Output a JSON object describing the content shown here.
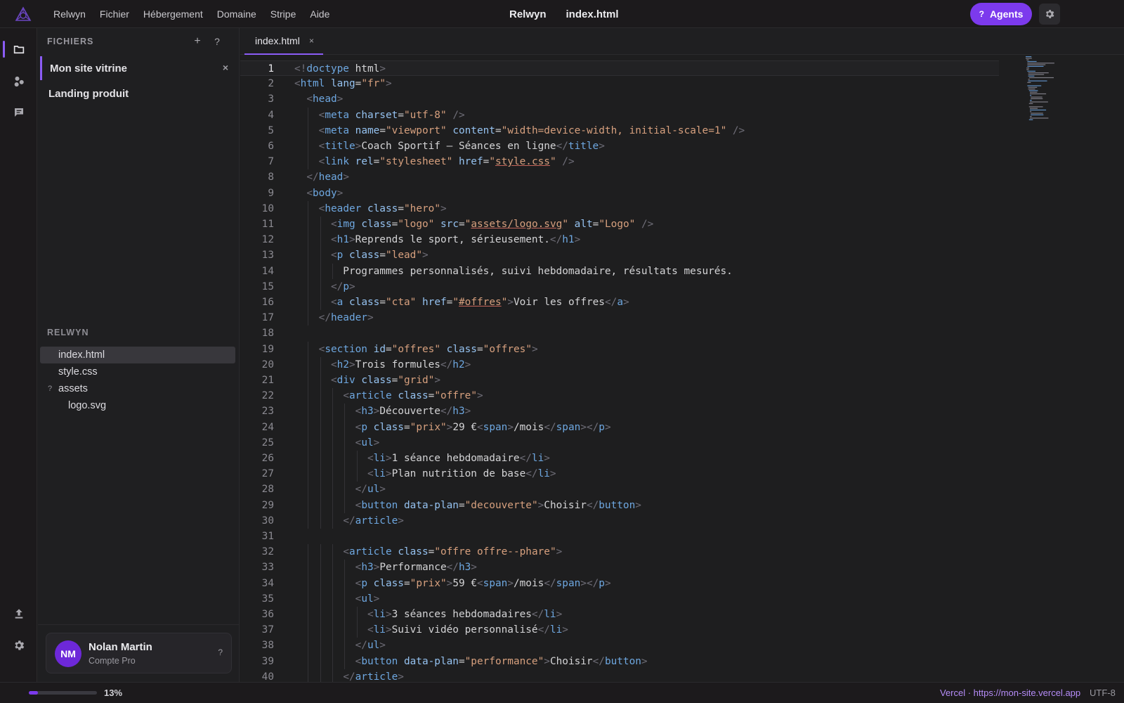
{
  "topbar": {
    "menu": [
      "Relwyn",
      "Fichier",
      "Hébergement",
      "Domaine",
      "Stripe",
      "Aide"
    ],
    "app_name": "Relwyn",
    "file_name": "index.html",
    "agents_q": "?",
    "agents_label": "Agents",
    "accent_color": "#7c3aed"
  },
  "activity_bar": {
    "icons": [
      "files-icon",
      "extensions-icon",
      "chat-icon",
      "upload-icon",
      "settings-icon"
    ]
  },
  "sidebar": {
    "header": "FICHIERS",
    "add_symbol": "+",
    "help_symbol": "?",
    "projects": [
      {
        "label": "Mon site vitrine",
        "active": true,
        "close": "×"
      },
      {
        "label": "Landing produit",
        "active": false
      }
    ],
    "section_label": "RELWYN",
    "tree": [
      {
        "label": "index.html",
        "active": true,
        "level": 0
      },
      {
        "label": "style.css",
        "level": 0
      },
      {
        "label": "assets",
        "level": 0,
        "marker": "?"
      },
      {
        "label": "logo.svg",
        "level": 1
      }
    ],
    "user": {
      "initials": "NM",
      "name": "Nolan Martin",
      "plan": "Compte Pro",
      "help": "?"
    }
  },
  "editor": {
    "tab_label": "index.html",
    "tab_close": "×",
    "current_line": 1,
    "lines": [
      "<!doctype html>",
      "<html lang=\"fr\">",
      "  <head>",
      "    <meta charset=\"utf-8\" />",
      "    <meta name=\"viewport\" content=\"width=device-width, initial-scale=1\" />",
      "    <title>Coach Sportif — Séances en ligne</title>",
      "    <link rel=\"stylesheet\" href=\"style.css\" />",
      "  </head>",
      "  <body>",
      "    <header class=\"hero\">",
      "      <img class=\"logo\" src=\"assets/logo.svg\" alt=\"Logo\" />",
      "      <h1>Reprends le sport, sérieusement.</h1>",
      "      <p class=\"lead\">",
      "        Programmes personnalisés, suivi hebdomadaire, résultats mesurés.",
      "      </p>",
      "      <a class=\"cta\" href=\"#offres\">Voir les offres</a>",
      "    </header>",
      "",
      "    <section id=\"offres\" class=\"offres\">",
      "      <h2>Trois formules</h2>",
      "      <div class=\"grid\">",
      "        <article class=\"offre\">",
      "          <h3>Découverte</h3>",
      "          <p class=\"prix\">29 €<span>/mois</span></p>",
      "          <ul>",
      "            <li>1 séance hebdomadaire</li>",
      "            <li>Plan nutrition de base</li>",
      "          </ul>",
      "          <button data-plan=\"decouverte\">Choisir</button>",
      "        </article>",
      "",
      "        <article class=\"offre offre--phare\">",
      "          <h3>Performance</h3>",
      "          <p class=\"prix\">59 €<span>/mois</span></p>",
      "          <ul>",
      "            <li>3 séances hebdomadaires</li>",
      "            <li>Suivi vidéo personnalisé</li>",
      "          </ul>",
      "          <button data-plan=\"performance\">Choisir</button>",
      "        </article>"
    ]
  },
  "status": {
    "progress": 0.13,
    "progress_label": "13%",
    "deploy": "Vercel · https://mon-site.vercel.app",
    "encoding": "UTF-8"
  }
}
